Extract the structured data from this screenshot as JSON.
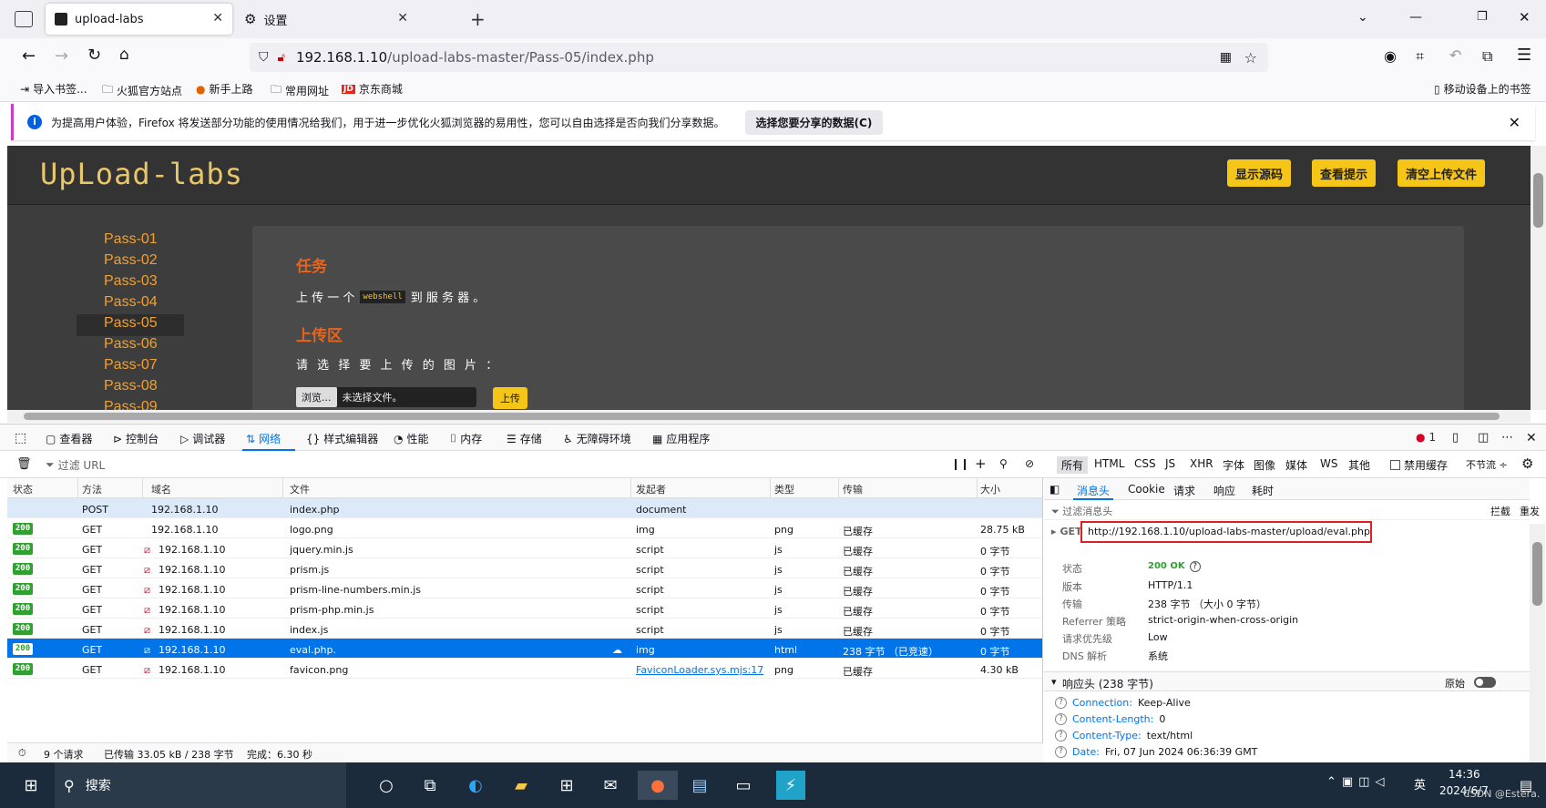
{
  "tabs": [
    {
      "label": "upload-labs",
      "active": true
    },
    {
      "label": "设置",
      "active": false
    }
  ],
  "url": {
    "host": "192.168.1.10",
    "path": "/upload-labs-master/Pass-05/index.php"
  },
  "bookmarks": {
    "items": [
      "导入书签...",
      "火狐官方站点",
      "新手上路",
      "常用网址",
      "京东商城"
    ],
    "mobile": "移动设备上的书签"
  },
  "notification": {
    "text": "为提高用户体验，Firefox 将发送部分功能的使用情况给我们，用于进一步优化火狐浏览器的易用性，您可以自由选择是否向我们分享数据。",
    "button": "选择您要分享的数据(C)"
  },
  "page": {
    "logo": "UpLoad-labs",
    "buttons": [
      "显示源码",
      "查看提示",
      "清空上传文件"
    ],
    "passes": [
      "Pass-01",
      "Pass-02",
      "Pass-03",
      "Pass-04",
      "Pass-05",
      "Pass-06",
      "Pass-07",
      "Pass-08",
      "Pass-09"
    ],
    "task_heading": "任务",
    "task_text_before": "上 传 一 个",
    "task_code": "webshell",
    "task_text_after": "到 服 务 器 。",
    "upload_heading": "上传区",
    "upload_text": "请 选 择 要 上 传 的 图 片 ：",
    "browse": "浏览...",
    "no_file": "未选择文件。",
    "upload_btn": "上传"
  },
  "devtools": {
    "tools": [
      "查看器",
      "控制台",
      "调试器",
      "网络",
      "样式编辑器",
      "性能",
      "内存",
      "存储",
      "无障碍环境",
      "应用程序"
    ],
    "error_count": "1",
    "filter_placeholder": "过滤 URL",
    "type_filters": [
      "所有",
      "HTML",
      "CSS",
      "JS",
      "XHR",
      "字体",
      "图像",
      "媒体",
      "WS",
      "其他"
    ],
    "disable_cache": "禁用缓存",
    "throttle": "不节流 ÷",
    "columns": [
      "状态",
      "方法",
      "域名",
      "文件",
      "发起者",
      "类型",
      "传输",
      "大小"
    ],
    "rows": [
      {
        "status": "",
        "method": "POST",
        "domain": "192.168.1.10",
        "file": "index.php",
        "initiator": "document",
        "type": "",
        "transfer": "",
        "size": ""
      },
      {
        "status": "200",
        "method": "GET",
        "domain": "192.168.1.10",
        "file": "logo.png",
        "initiator": "img",
        "type": "png",
        "transfer": "已缓存",
        "size": "28.75 kB"
      },
      {
        "status": "200",
        "method": "GET",
        "domain": "192.168.1.10",
        "file": "jquery.min.js",
        "initiator": "script",
        "type": "js",
        "transfer": "已缓存",
        "size": "0 字节"
      },
      {
        "status": "200",
        "method": "GET",
        "domain": "192.168.1.10",
        "file": "prism.js",
        "initiator": "script",
        "type": "js",
        "transfer": "已缓存",
        "size": "0 字节"
      },
      {
        "status": "200",
        "method": "GET",
        "domain": "192.168.1.10",
        "file": "prism-line-numbers.min.js",
        "initiator": "script",
        "type": "js",
        "transfer": "已缓存",
        "size": "0 字节"
      },
      {
        "status": "200",
        "method": "GET",
        "domain": "192.168.1.10",
        "file": "prism-php.min.js",
        "initiator": "script",
        "type": "js",
        "transfer": "已缓存",
        "size": "0 字节"
      },
      {
        "status": "200",
        "method": "GET",
        "domain": "192.168.1.10",
        "file": "index.js",
        "initiator": "script",
        "type": "js",
        "transfer": "已缓存",
        "size": "0 字节"
      },
      {
        "status": "200",
        "method": "GET",
        "domain": "192.168.1.10",
        "file": "eval.php.",
        "initiator": "img",
        "type": "html",
        "transfer": "238 字节 （已竞速）",
        "size": "0 字节"
      },
      {
        "status": "200",
        "method": "GET",
        "domain": "192.168.1.10",
        "file": "favicon.png",
        "initiator": "FaviconLoader.sys.mjs:17...",
        "type": "png",
        "transfer": "已缓存",
        "size": "4.30 kB"
      }
    ],
    "footer": {
      "requests": "9 个请求",
      "transferred": "已传输 33.05 kB / 238 字节",
      "finished": "完成：6.30 秒"
    },
    "side": {
      "tabs": [
        "消息头",
        "Cookie",
        "请求",
        "响应",
        "耗时"
      ],
      "filter_placeholder": "过滤消息头",
      "block": "拦截",
      "resend": "重发",
      "method": "GET",
      "url": "http://192.168.1.10/upload-labs-master/upload/eval.php.",
      "info": [
        {
          "k": "状态",
          "v": "200 OK"
        },
        {
          "k": "版本",
          "v": "HTTP/1.1"
        },
        {
          "k": "传输",
          "v": "238 字节 （大小 0 字节）"
        },
        {
          "k": "Referrer 策略",
          "v": "strict-origin-when-cross-origin"
        },
        {
          "k": "请求优先级",
          "v": "Low"
        },
        {
          "k": "DNS 解析",
          "v": "系统"
        }
      ],
      "response_headers_title": "响应头 (238 字节)",
      "raw": "原始",
      "headers": [
        {
          "k": "Connection:",
          "v": "Keep-Alive"
        },
        {
          "k": "Content-Length:",
          "v": "0"
        },
        {
          "k": "Content-Type:",
          "v": "text/html"
        },
        {
          "k": "Date:",
          "v": "Fri, 07 Jun 2024 06:36:39 GMT"
        }
      ]
    }
  },
  "taskbar": {
    "search": "搜索",
    "ime": "英",
    "time": "14:36",
    "date": "2024/6/7",
    "watermark": "CSDN @Estera."
  },
  "colors": {
    "accent": "#0074e8",
    "status_ok": "#30a030",
    "page_bg": "#3d3d3d",
    "pass_link": "#f0a030",
    "heading": "#e8641b",
    "yellow_btn": "#f5c518"
  }
}
